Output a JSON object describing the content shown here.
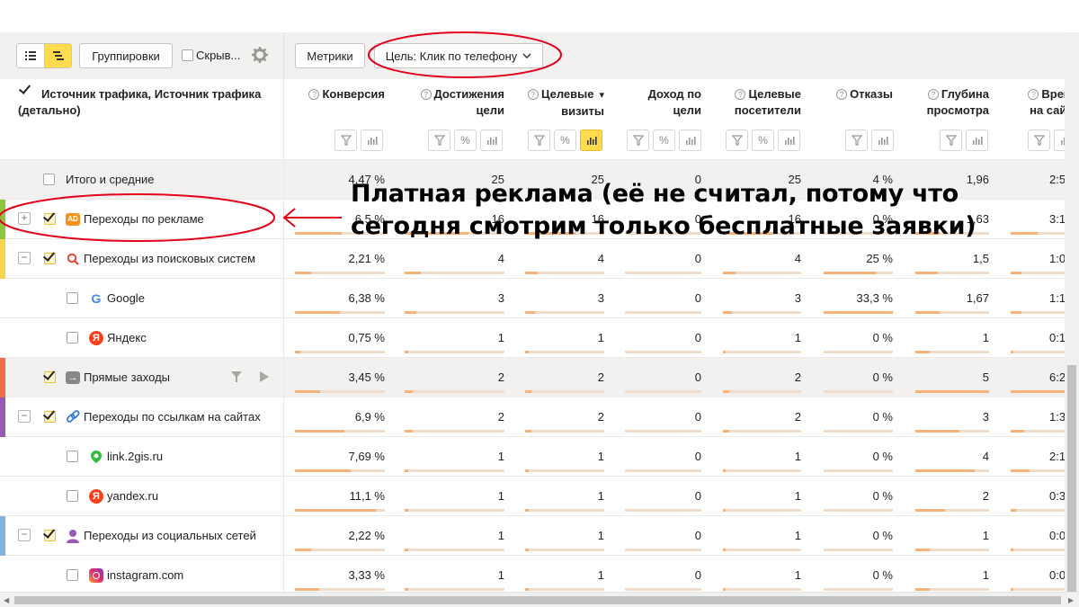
{
  "toolbar": {
    "groupings_label": "Группировки",
    "hide_label": "Скрыв...",
    "metrics_label": "Метрики",
    "goal_label": "Цель: Клик по телефону"
  },
  "header": {
    "dimension_title": "Источник трафика, Источник трафика (детально)",
    "columns": [
      {
        "line1": "Конверсия",
        "line2": ""
      },
      {
        "line1": "Достижения",
        "line2": "цели"
      },
      {
        "line1": "Целевые",
        "line2": "визиты",
        "sort": "▾"
      },
      {
        "line1": "Доход по",
        "line2": "цели"
      },
      {
        "line1": "Целевые",
        "line2": "посетители"
      },
      {
        "line1": "Отказы",
        "line2": ""
      },
      {
        "line1": "Глубина",
        "line2": "просмотра"
      },
      {
        "line1": "Время",
        "line2": "на сайте"
      }
    ]
  },
  "rows": [
    {
      "label": "Итого и средние",
      "values": [
        "4,47 %",
        "25",
        "25",
        "0",
        "25",
        "4 %",
        "1,96",
        "2:5"
      ]
    },
    {
      "label": "Переходы по рекламе",
      "values": [
        "6,5 %",
        "16",
        "16",
        "0",
        "16",
        "0 %",
        "1,63",
        "3:1"
      ]
    },
    {
      "label": "Переходы из поисковых систем",
      "values": [
        "2,21 %",
        "4",
        "4",
        "0",
        "4",
        "25 %",
        "1,5",
        "1:0"
      ]
    },
    {
      "label": "Google",
      "values": [
        "6,38 %",
        "3",
        "3",
        "0",
        "3",
        "33,3 %",
        "1,67",
        "1:1"
      ]
    },
    {
      "label": "Яндекс",
      "values": [
        "0,75 %",
        "1",
        "1",
        "0",
        "1",
        "0 %",
        "1",
        "0:1"
      ]
    },
    {
      "label": "Прямые заходы",
      "values": [
        "3,45 %",
        "2",
        "2",
        "0",
        "2",
        "0 %",
        "5",
        "6:2"
      ]
    },
    {
      "label": "Переходы по ссылкам на сайтах",
      "values": [
        "6,9 %",
        "2",
        "2",
        "0",
        "2",
        "0 %",
        "3",
        "1:3"
      ]
    },
    {
      "label": "link.2gis.ru",
      "values": [
        "7,69 %",
        "1",
        "1",
        "0",
        "1",
        "0 %",
        "4",
        "2:1"
      ]
    },
    {
      "label": "yandex.ru",
      "values": [
        "11,1 %",
        "1",
        "1",
        "0",
        "1",
        "0 %",
        "2",
        "0:3"
      ]
    },
    {
      "label": "Переходы из социальных сетей",
      "values": [
        "2,22 %",
        "1",
        "1",
        "0",
        "1",
        "0 %",
        "1",
        "0:0"
      ]
    },
    {
      "label": "instagram.com",
      "values": [
        "3,33 %",
        "1",
        "1",
        "0",
        "1",
        "0 %",
        "1",
        "0:0"
      ]
    }
  ],
  "bars": [
    [
      0,
      0,
      0,
      0,
      0,
      0,
      0,
      0
    ],
    [
      0.52,
      0.64,
      0.64,
      0,
      0.64,
      0,
      0.33,
      0.5
    ],
    [
      0.18,
      0.16,
      0.16,
      0,
      0.16,
      0.75,
      0.3,
      0.2
    ],
    [
      0.5,
      0.12,
      0.12,
      0,
      0.12,
      1.0,
      0.33,
      0.2
    ],
    [
      0.06,
      0.04,
      0.04,
      0,
      0.04,
      0,
      0.2,
      0.05
    ],
    [
      0.28,
      0.08,
      0.08,
      0,
      0.08,
      0,
      1.0,
      1.0
    ],
    [
      0.55,
      0.08,
      0.08,
      0,
      0.08,
      0,
      0.6,
      0.25
    ],
    [
      0.62,
      0.04,
      0.04,
      0,
      0.04,
      0,
      0.8,
      0.35
    ],
    [
      0.9,
      0.04,
      0.04,
      0,
      0.04,
      0,
      0.4,
      0.1
    ],
    [
      0.18,
      0.04,
      0.04,
      0,
      0.04,
      0,
      0.2,
      0.05
    ],
    [
      0.27,
      0.04,
      0.04,
      0,
      0.04,
      0,
      0.2,
      0.05
    ]
  ],
  "annotation": {
    "text": "Платная реклама (её не считал, потому что сегодня смотрим только бесплатные заявки)"
  },
  "colors": {
    "accent": "#ffdb4d",
    "bar": "#f5b27a",
    "annotation": "#e3001b",
    "stripe_ads": "#8cc63f",
    "stripe_search": "#f7d44c",
    "stripe_direct": "#f26b4b",
    "stripe_links": "#9b59b6",
    "stripe_social": "#7fb3e0"
  }
}
